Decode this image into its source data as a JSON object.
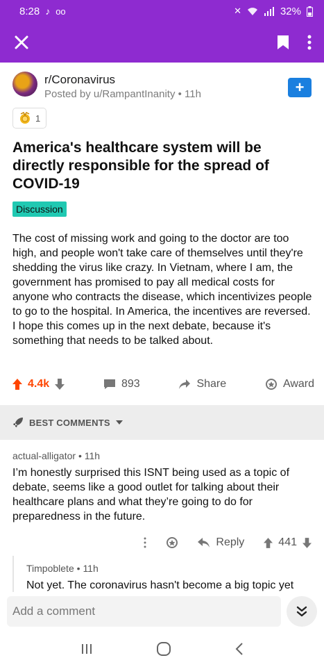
{
  "status": {
    "time": "8:28",
    "battery": "32%"
  },
  "post": {
    "subreddit": "r/Coronavirus",
    "posted_by": "Posted by u/RampantInanity",
    "age": "11h",
    "award_count": "1",
    "title": "America's healthcare system will be directly responsible for the spread of COVID-19",
    "flair": "Discussion",
    "body": "The cost of missing work and going to the doctor are too high, and people won't take care of themselves until they're shedding the virus like crazy. In Vietnam, where I am, the government has promised to pay all medical costs for anyone who contracts the disease, which incentivizes people to go to the hospital. In America, the incentives are reversed. I hope this comes up in the next debate, because it's something that needs to be talked about.",
    "votes": "4.4k",
    "comments": "893",
    "share_label": "Share",
    "award_label": "Award"
  },
  "sort": {
    "label": "BEST COMMENTS"
  },
  "comments": [
    {
      "author": "actual-alligator",
      "age": "11h",
      "body": "I’m honestly surprised this ISNT being used as a topic of debate, seems like a good outlet for talking about their healthcare plans and what they’re going to do for preparedness in the future.",
      "reply_label": "Reply",
      "votes": "441"
    },
    {
      "author": "Timpoblete",
      "age": "11h",
      "body": "Not yet. The coronavirus hasn't become a big topic yet"
    }
  ],
  "composer": {
    "placeholder": "Add a comment"
  },
  "colors": {
    "header": "#8e2bd0",
    "upvote": "#ff4500",
    "join": "#1a7fdf",
    "flair": "#20c9b2"
  }
}
